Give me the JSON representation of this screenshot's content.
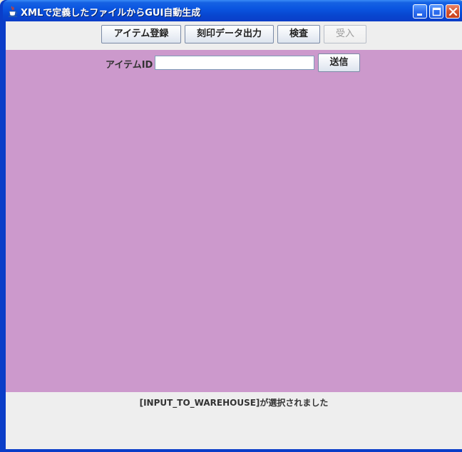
{
  "window": {
    "title": "XMLで定義したファイルからGUI自動生成",
    "icon": "java-cup-icon",
    "controls": [
      "minimize-icon",
      "maximize-icon",
      "close-icon"
    ]
  },
  "toolbar": {
    "buttons": [
      {
        "label": "アイテム登録",
        "enabled": true
      },
      {
        "label": "刻印データ出力",
        "enabled": true
      },
      {
        "label": "検査",
        "enabled": true
      },
      {
        "label": "受入",
        "enabled": false
      }
    ]
  },
  "form": {
    "item_id_label": "アイテムID",
    "item_id_value": "",
    "submit_label": "送信"
  },
  "status": {
    "message": "[INPUT_TO_WAREHOUSE]が選択されました"
  },
  "colors": {
    "panel_background": "#CC99CC",
    "titlebar": "#0A55E0",
    "client_background": "#EEEEEE"
  }
}
